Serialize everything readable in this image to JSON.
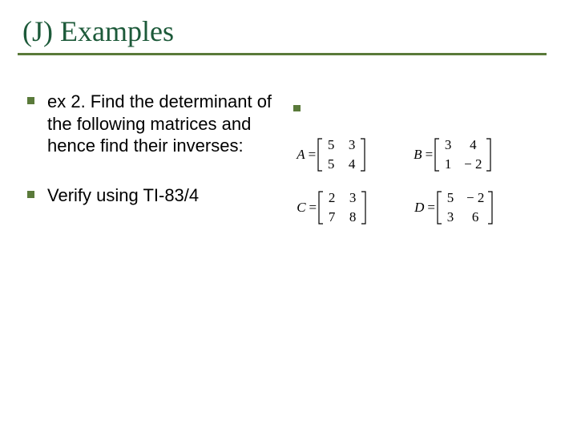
{
  "title": "(J) Examples",
  "left": {
    "item1": "ex 2. Find the determinant of the following matrices and hence find their inverses:",
    "item2": "Verify using TI-83/4"
  },
  "matrices": {
    "A": {
      "label": "A",
      "r1c1": "5",
      "r1c2": "3",
      "r2c1": "5",
      "r2c2": "4"
    },
    "B": {
      "label": "B",
      "r1c1": "3",
      "r1c2": "4",
      "r2c1": "1",
      "r2c2": "− 2"
    },
    "C": {
      "label": "C",
      "r1c1": "2",
      "r1c2": "3",
      "r2c1": "7",
      "r2c2": "8"
    },
    "D": {
      "label": "D",
      "r1c1": "5",
      "r1c2": "− 2",
      "r2c1": "3",
      "r2c2": "6"
    }
  }
}
